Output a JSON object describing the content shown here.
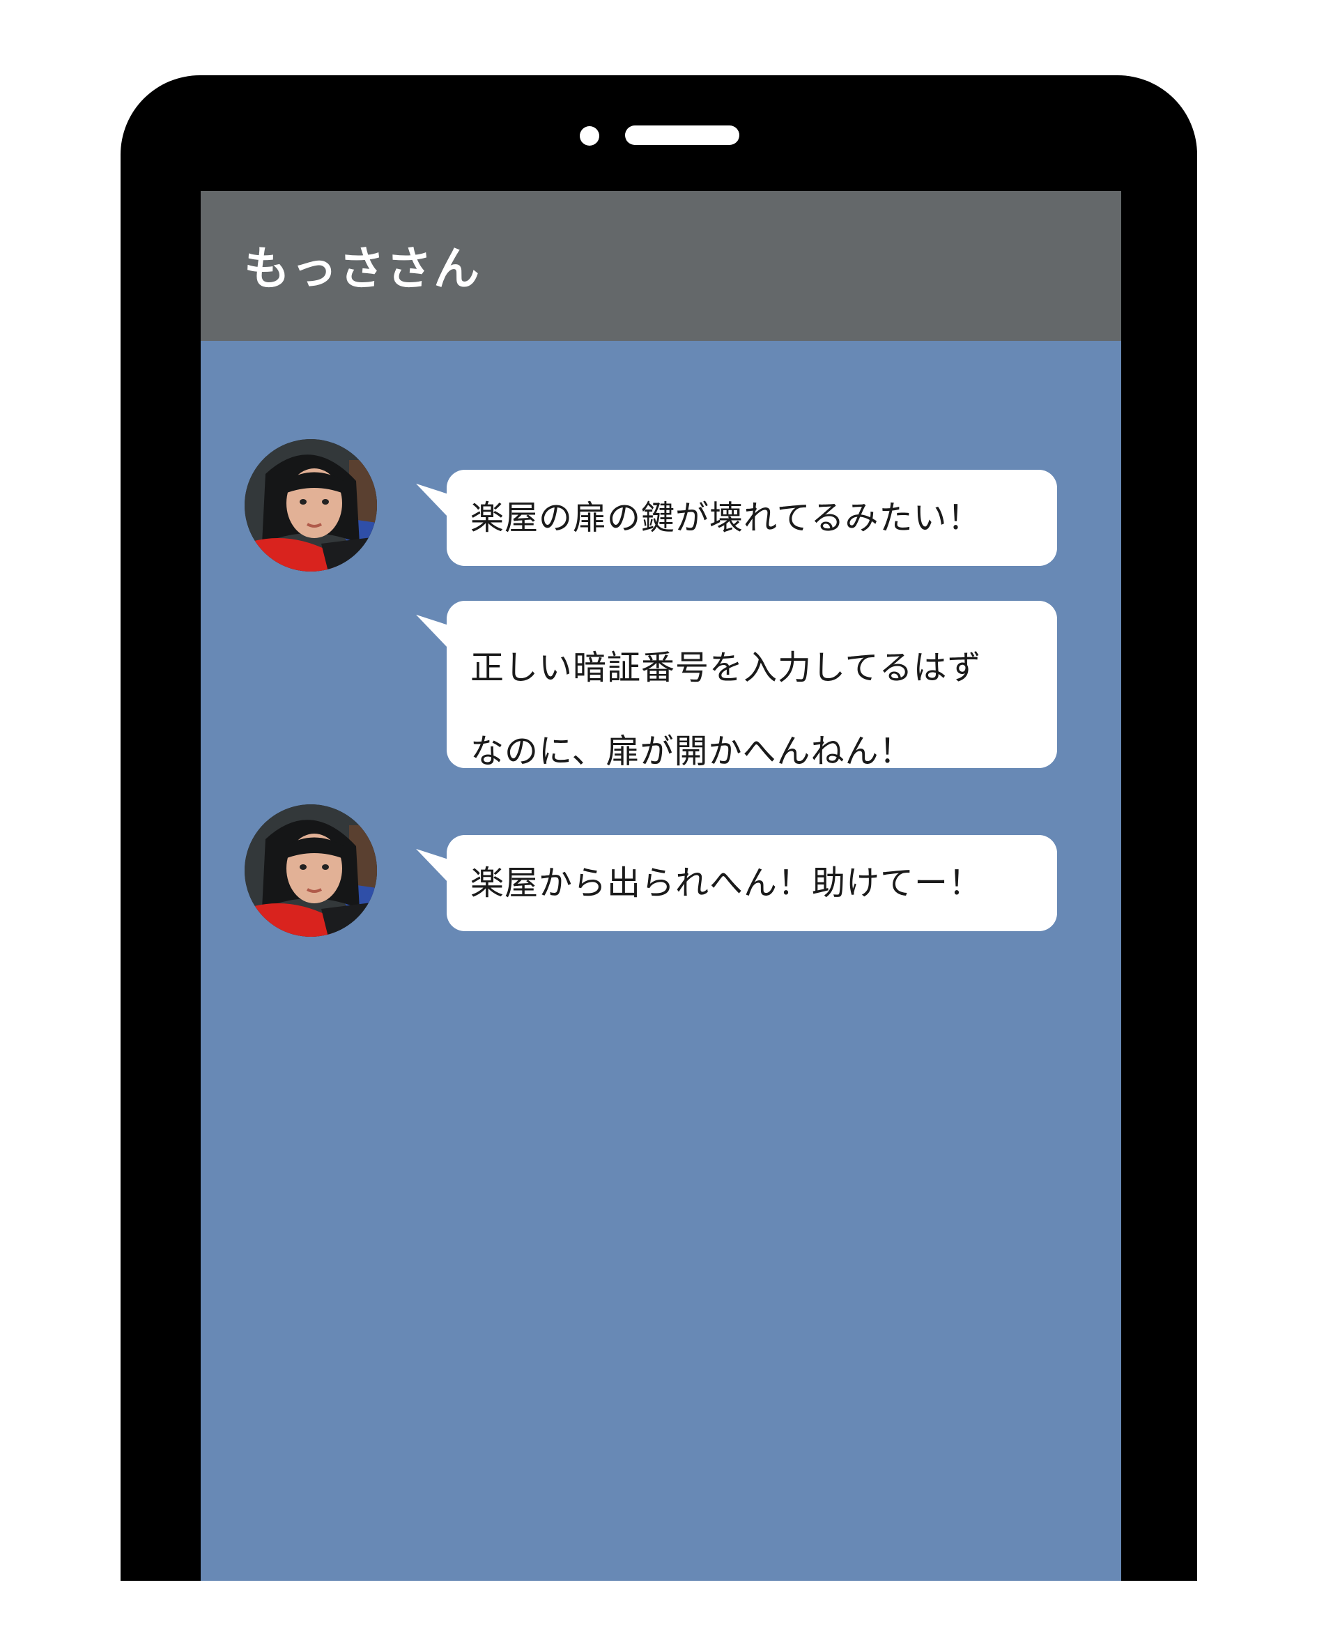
{
  "chat": {
    "title": "もっささん"
  },
  "messages": [
    {
      "text": "楽屋の扉の鍵が壊れてるみたい！",
      "avatar": "sender-avatar"
    },
    {
      "lines": [
        "正しい暗証番号を入力してるはず",
        "なのに、扉が開かへんねん！"
      ]
    },
    {
      "text": "楽屋から出られへん！助けてー！",
      "avatar": "sender-avatar"
    }
  ],
  "colors": {
    "frame": "#000000",
    "header": "#64686a",
    "chat_background": "#6889b5",
    "bubble": "#ffffff",
    "title_text": "#ffffff",
    "message_text": "#1a1a1a"
  }
}
